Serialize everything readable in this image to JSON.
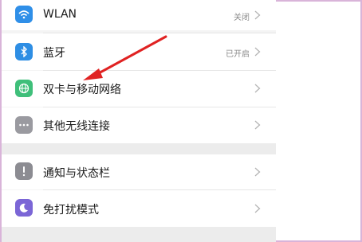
{
  "settings": {
    "items": [
      {
        "label": "WLAN",
        "status": "关闭",
        "icon": "wifi-icon",
        "color": "#2f8fe8"
      },
      {
        "label": "蓝牙",
        "status": "已开启",
        "icon": "bluetooth-icon",
        "color": "#2e8ee4"
      },
      {
        "label": "双卡与移动网络",
        "status": "",
        "icon": "globe-icon",
        "color": "#3fbf7a"
      },
      {
        "label": "其他无线连接",
        "status": "",
        "icon": "more-icon",
        "color": "#9a9aa0"
      },
      {
        "label": "通知与状态栏",
        "status": "",
        "icon": "notification-icon",
        "color": "#8c8c92"
      },
      {
        "label": "免打扰模式",
        "status": "",
        "icon": "moon-icon",
        "color": "#7b66d6"
      }
    ]
  },
  "colors": {
    "annotation_arrow": "#e02222",
    "frame_border": "#d9b4d9"
  }
}
